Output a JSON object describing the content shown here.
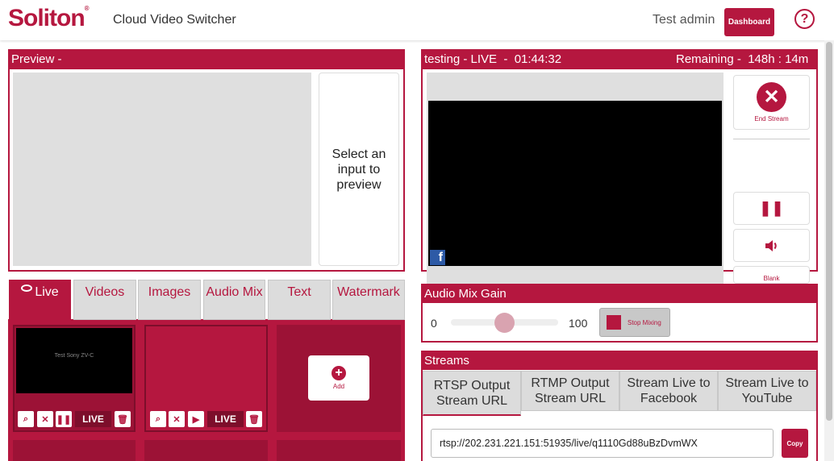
{
  "header": {
    "logo": "Soliton",
    "app_title": "Cloud Video Switcher",
    "user": "Test admin",
    "dashboard_label": "Dashboard",
    "help_glyph": "?"
  },
  "preview": {
    "title": "Preview -",
    "message": "Select an input to preview"
  },
  "live": {
    "status": "testing - LIVE  -  01:44:32",
    "remaining": "Remaining -  148h : 14m",
    "destination_icon": "facebook-icon",
    "end_stream_label": "End Stream",
    "blank_label": "Blank"
  },
  "audio_mix": {
    "title": "Audio Mix Gain",
    "min": "0",
    "max": "100",
    "level": 50,
    "stop_label": "Stop Mixing"
  },
  "streams": {
    "title": "Streams",
    "tabs": [
      {
        "label": "RTSP Output Stream URL"
      },
      {
        "label": "RTMP Output Stream URL"
      },
      {
        "label": "Stream Live to Facebook"
      },
      {
        "label": "Stream Live to YouTube"
      }
    ],
    "url": "rtsp://202.231.221.151:51935/live/q1110Gd88uBzDvmWX",
    "copy_label": "Copy"
  },
  "sources": {
    "tabs": [
      {
        "label": "Live"
      },
      {
        "label": "Videos"
      },
      {
        "label": "Images"
      },
      {
        "label": "Audio Mix"
      },
      {
        "label": "Text"
      },
      {
        "label": "Watermark"
      }
    ],
    "card1_text": "Test Sony ZV-C",
    "live_badge": "LIVE",
    "add_label": "Add"
  },
  "colors": {
    "brand": "#b5173f",
    "card_dark": "#9c1236"
  }
}
